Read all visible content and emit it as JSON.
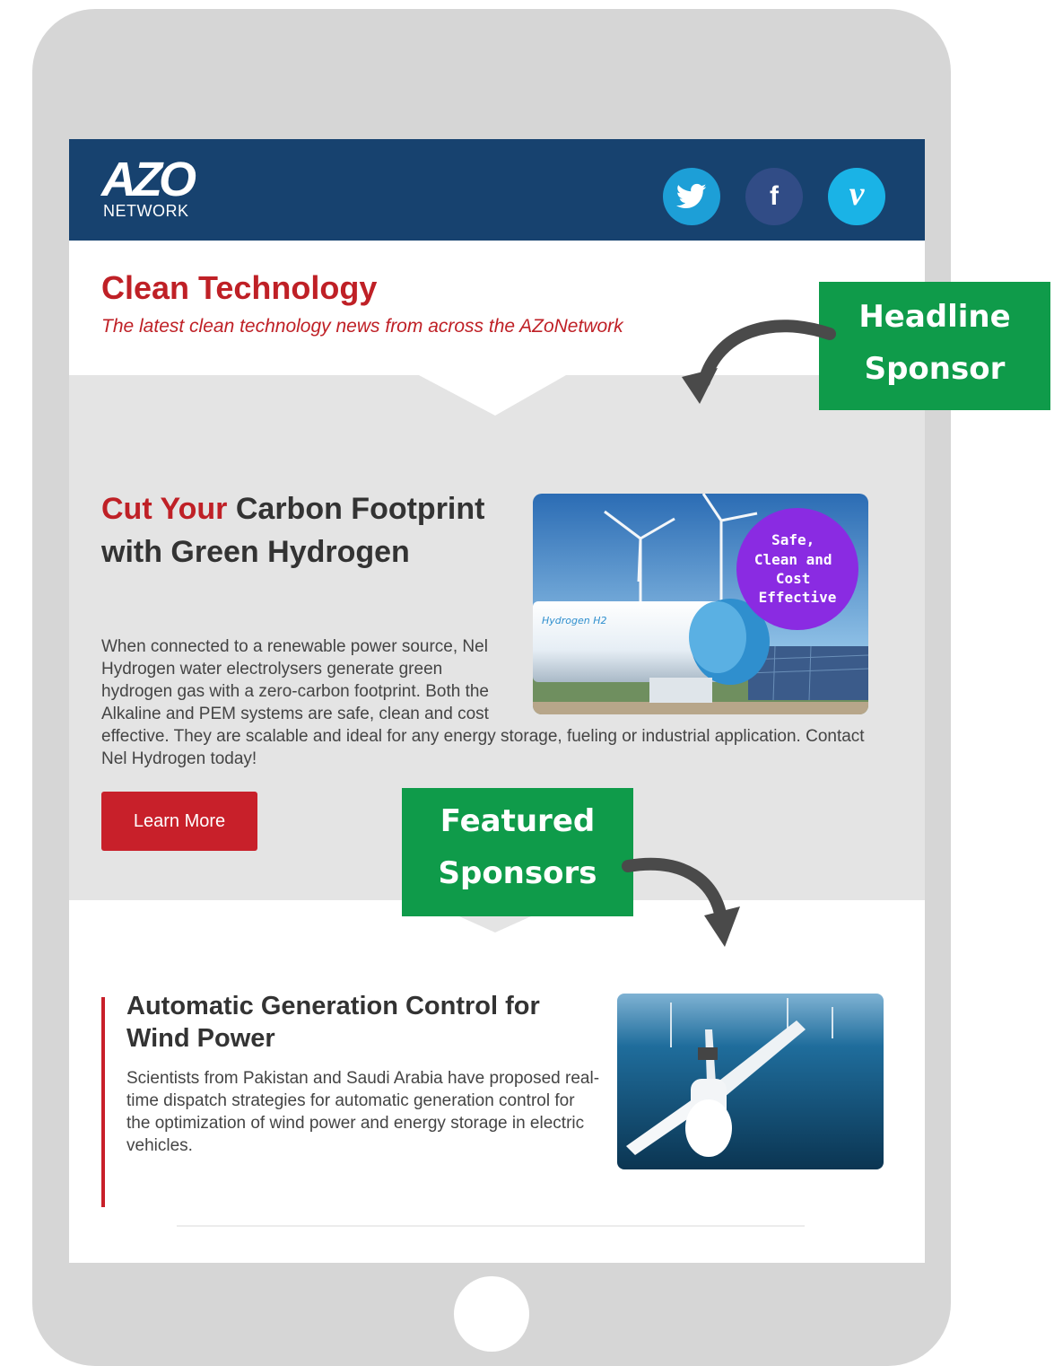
{
  "header": {
    "logo_main": "AZO",
    "logo_sub": "NETWORK"
  },
  "social": [
    {
      "name": "twitter-icon"
    },
    {
      "name": "facebook-icon",
      "glyph": "f"
    },
    {
      "name": "vimeo-icon",
      "glyph": "v"
    }
  ],
  "page": {
    "title": "Clean Technology",
    "subtitle": "The latest clean technology news from across the AZoNetwork"
  },
  "headline": {
    "title_accent": "Cut Your",
    "title_rest": " Carbon Footprint with Green Hydrogen",
    "body": "When connected to a renewable power source, Nel Hydrogen water electrolysers generate green hydrogen gas with a zero-carbon footprint. Both the Alkaline and PEM systems are safe, clean and cost effective. They are scalable and ideal for any energy storage, fueling or industrial application. Contact Nel Hydrogen today!",
    "button_label": "Learn More",
    "image_badge": [
      "Safe,",
      "Clean and",
      "Cost",
      "Effective"
    ],
    "tank_label": "Hydrogen H2"
  },
  "article": {
    "title": "Automatic Generation Control for Wind Power",
    "body": "Scientists from Pakistan and Saudi Arabia have proposed real-time dispatch strategies for automatic generation control for the optimization of wind power and energy storage in electric vehicles."
  },
  "callouts": {
    "headline": [
      "Headline",
      "Sponsor"
    ],
    "featured": [
      "Featured",
      "Sponsors"
    ]
  },
  "colors": {
    "header_bg": "#17426f",
    "accent_red": "#bf2026",
    "callout_green": "#0f9b4a",
    "section_gray": "#e4e4e4",
    "tablet_frame": "#d6d6d6"
  }
}
